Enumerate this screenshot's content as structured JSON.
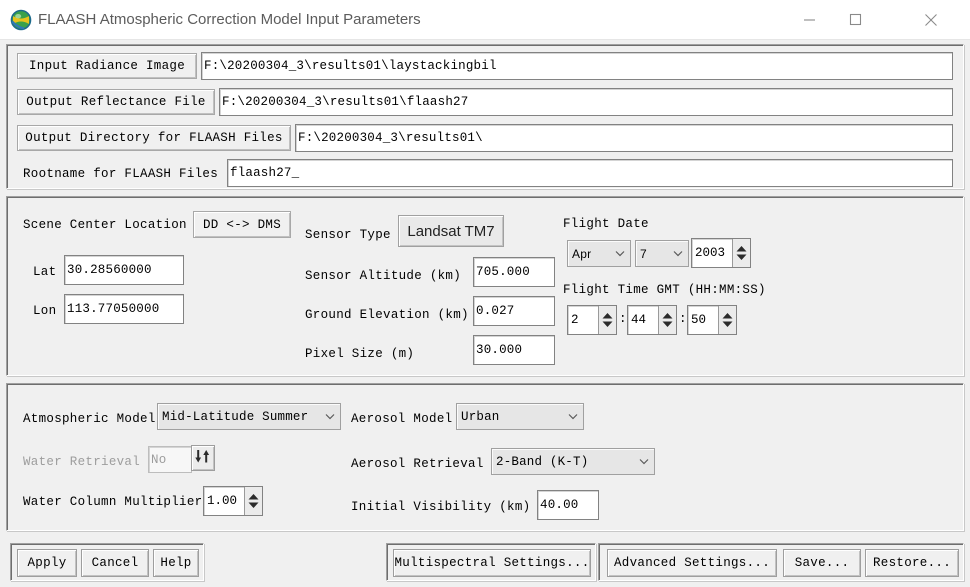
{
  "window": {
    "title": "FLAASH Atmospheric Correction Model Input Parameters",
    "icon": "flaash-globe-icon",
    "controls": {
      "minimize": "minimize-icon",
      "maximize": "maximize-icon",
      "close": "close-icon"
    }
  },
  "colors": {
    "face": "#f0f0f0",
    "field_bg": "#ffffff",
    "border": "#828282",
    "title_text": "#5c5c5c",
    "disabled_text": "#9d9d9d",
    "sensor_text": "#222222"
  },
  "files": {
    "input_radiance_label": "Input Radiance Image",
    "input_radiance_value": "F:\\20200304_3\\results01\\laystackingbil",
    "output_reflectance_label": "Output Reflectance File",
    "output_reflectance_value": "F:\\20200304_3\\results01\\flaash27",
    "output_directory_label": "Output Directory for FLAASH Files",
    "output_directory_value": "F:\\20200304_3\\results01\\",
    "rootname_label": "Rootname for FLAASH Files",
    "rootname_value": "flaash27_"
  },
  "scene": {
    "center_location_label": "Scene Center Location",
    "dd_dms_button": "DD <-> DMS",
    "lat_label": "Lat",
    "lat_value": "30.28560000",
    "lon_label": "Lon",
    "lon_value": "113.77050000"
  },
  "sensor": {
    "type_label": "Sensor Type",
    "type_value": "Landsat TM7",
    "altitude_label": "Sensor Altitude (km)",
    "altitude_value": "705.000",
    "ground_elevation_label": "Ground Elevation (km)",
    "ground_elevation_value": "0.027",
    "pixel_size_label": "Pixel Size (m)",
    "pixel_size_value": "30.000"
  },
  "flight": {
    "date_label": "Flight Date",
    "month_value": "Apr",
    "day_value": "7",
    "year_value": "2003",
    "time_label": "Flight Time GMT (HH:MM:SS)",
    "hour_value": "2",
    "minute_value": "44",
    "second_value": "50",
    "time_sep": ":"
  },
  "atmosphere": {
    "atmospheric_model_label": "Atmospheric Model",
    "atmospheric_model_value": "Mid-Latitude Summer",
    "water_retrieval_label": "Water Retrieval",
    "water_retrieval_value": "No",
    "water_retrieval_toggle_icon": "up-down-arrows-icon",
    "water_column_multiplier_label": "Water Column Multiplier",
    "water_column_multiplier_value": "1.00",
    "aerosol_model_label": "Aerosol Model",
    "aerosol_model_value": "Urban",
    "aerosol_retrieval_label": "Aerosol Retrieval",
    "aerosol_retrieval_value": "2-Band (K-T)",
    "initial_visibility_label": "Initial Visibility (km)",
    "initial_visibility_value": "40.00"
  },
  "actions": {
    "apply": "Apply",
    "cancel": "Cancel",
    "help": "Help",
    "multispectral_settings": "Multispectral Settings...",
    "advanced_settings": "Advanced Settings...",
    "save": "Save...",
    "restore": "Restore..."
  }
}
